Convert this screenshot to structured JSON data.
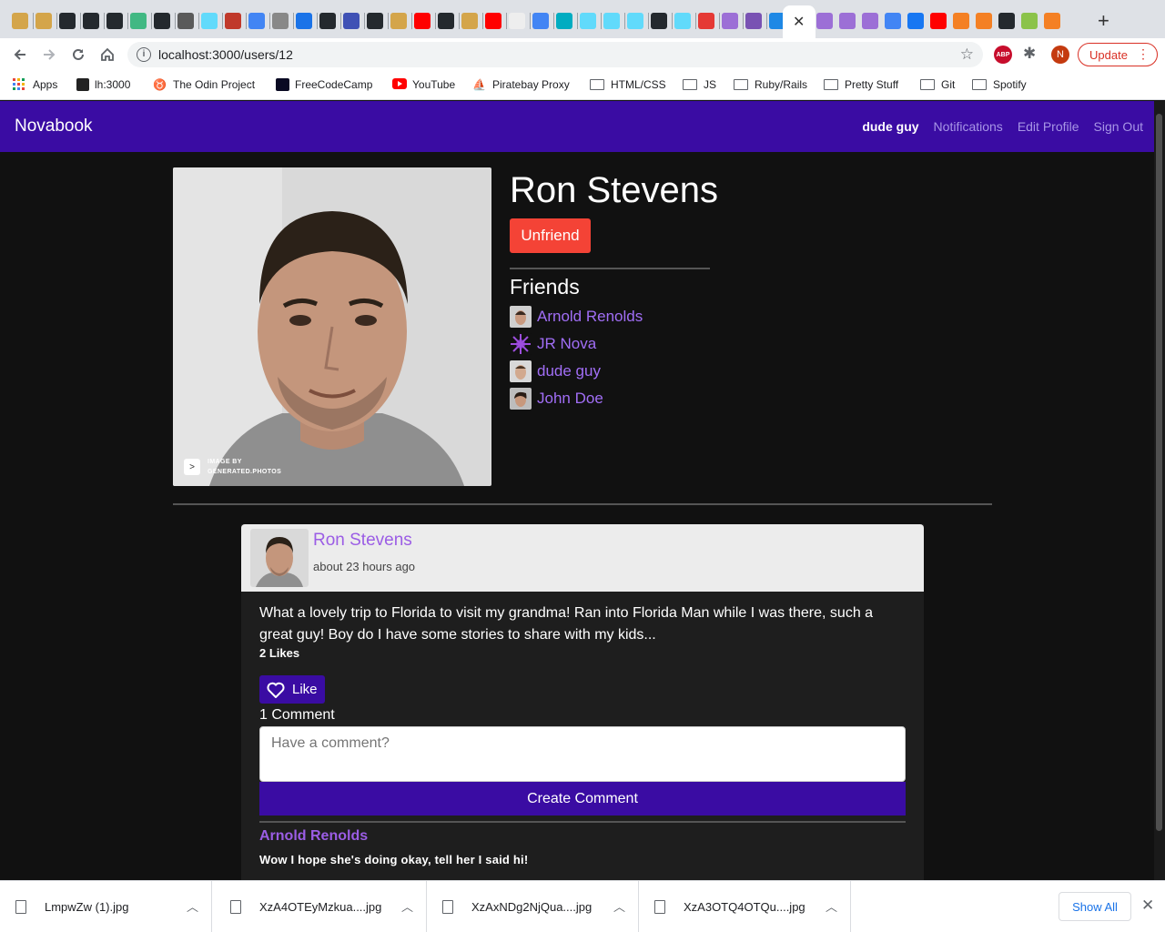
{
  "browser": {
    "url": "localhost:3000/users/12",
    "update_label": "Update",
    "profile_initial": "N",
    "abp_label": "ABP",
    "bookmarks": [
      {
        "label": "Apps",
        "icon": "apps-grid-icon"
      },
      {
        "label": "lh:3000",
        "icon": "localhost-icon"
      },
      {
        "label": "The Odin Project",
        "icon": "odin-icon"
      },
      {
        "label": "FreeCodeCamp",
        "icon": "freecodecamp-icon"
      },
      {
        "label": "YouTube",
        "icon": "youtube-icon"
      },
      {
        "label": "Piratebay Proxy",
        "icon": "pirate-icon"
      },
      {
        "label": "HTML/CSS",
        "icon": "folder-icon"
      },
      {
        "label": "JS",
        "icon": "folder-icon"
      },
      {
        "label": "Ruby/Rails",
        "icon": "folder-icon"
      },
      {
        "label": "Pretty Stuff",
        "icon": "folder-icon"
      },
      {
        "label": "Git",
        "icon": "folder-icon"
      },
      {
        "label": "Spotify",
        "icon": "folder-icon"
      }
    ]
  },
  "nav": {
    "brand": "Novabook",
    "links": [
      "dude guy",
      "Notifications",
      "Edit Profile",
      "Sign Out"
    ]
  },
  "profile": {
    "name": "Ron Stevens",
    "unfriend_label": "Unfriend",
    "photo_badge_line1": "IMAGE BY",
    "photo_badge_line2": "GENERATED.PHOTOS",
    "friends_heading": "Friends",
    "friends": [
      "Arnold Renolds",
      "JR Nova",
      "dude guy",
      "John Doe"
    ]
  },
  "post": {
    "author": "Ron Stevens",
    "time": "about 23 hours ago",
    "body": "What a lovely trip to Florida to visit my grandma! Ran into Florida Man while I was there, such a great guy! Boy do I have some stories to share with my kids...",
    "likes": "2 Likes",
    "like_label": "Like",
    "comment_count": "1 Comment",
    "comment_placeholder": "Have a comment?",
    "create_label": "Create Comment",
    "comments": [
      {
        "author": "Arnold Renolds",
        "text": "Wow I hope she's doing okay, tell her I said hi!"
      }
    ]
  },
  "downloads": {
    "files": [
      "LmpwZw (1).jpg",
      "XzA4OTEyMzkua....jpg",
      "XzAxNDg2NjQua....jpg",
      "XzA3OTQ4OTQu....jpg"
    ],
    "show_all": "Show All"
  },
  "colors": {
    "brand_purple": "#3a0ca3",
    "link_purple": "#9b5de5",
    "unfriend_red": "#f44336"
  }
}
